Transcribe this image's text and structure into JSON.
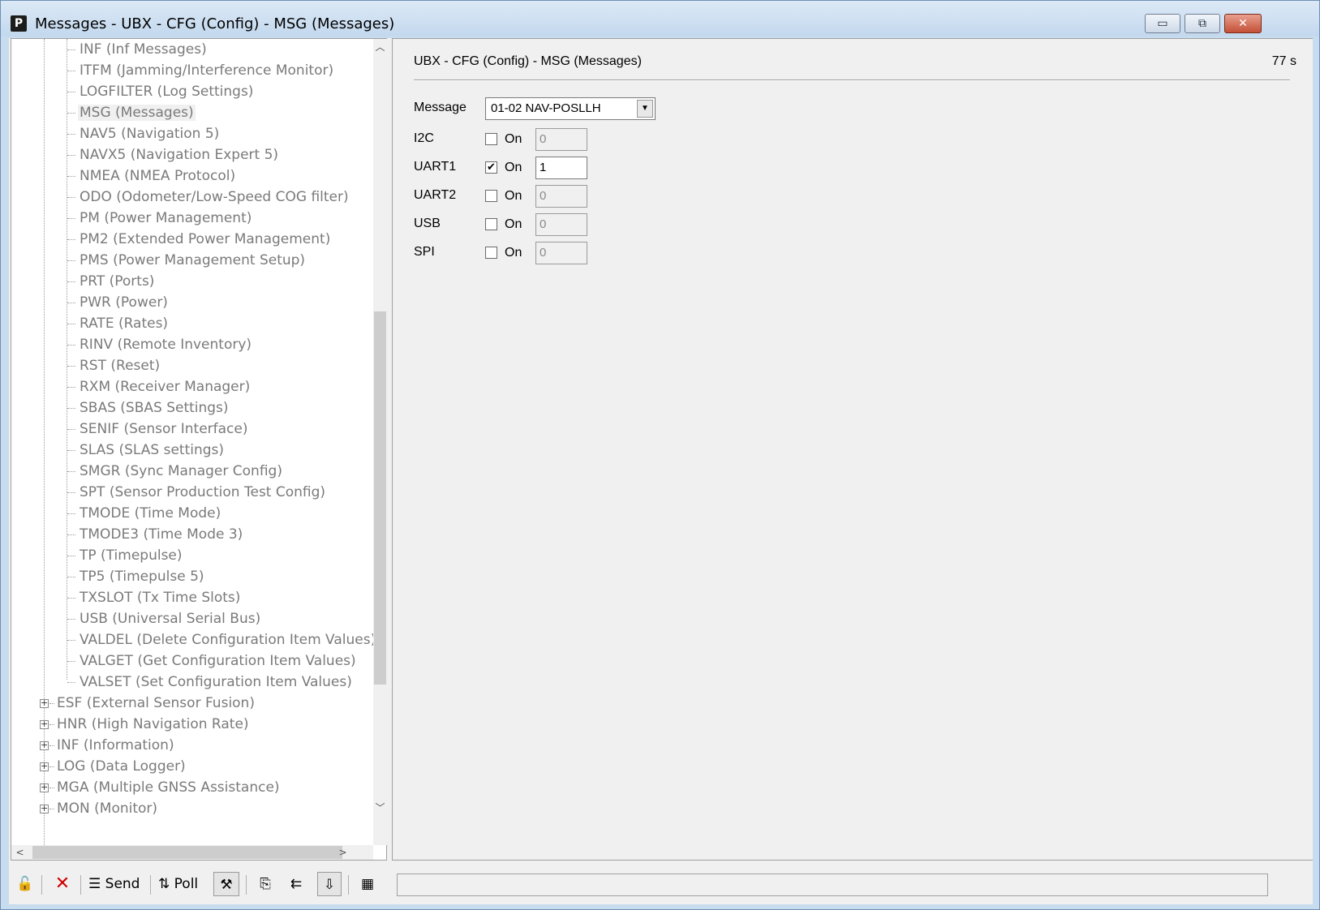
{
  "window": {
    "title": "Messages - UBX - CFG (Config) - MSG (Messages)",
    "app_icon_letter": "P",
    "minimize_glyph": "▭",
    "restore_glyph": "⧉",
    "close_glyph": "✕"
  },
  "tree": {
    "children": [
      "INF (Inf Messages)",
      "ITFM (Jamming/Interference Monitor)",
      "LOGFILTER (Log Settings)",
      "MSG (Messages)",
      "NAV5 (Navigation 5)",
      "NAVX5 (Navigation Expert 5)",
      "NMEA (NMEA Protocol)",
      "ODO (Odometer/Low-Speed COG filter)",
      "PM (Power Management)",
      "PM2 (Extended Power Management)",
      "PMS (Power Management Setup)",
      "PRT (Ports)",
      "PWR (Power)",
      "RATE (Rates)",
      "RINV (Remote Inventory)",
      "RST (Reset)",
      "RXM (Receiver Manager)",
      "SBAS (SBAS Settings)",
      "SENIF (Sensor Interface)",
      "SLAS (SLAS settings)",
      "SMGR (Sync Manager Config)",
      "SPT (Sensor Production Test Config)",
      "TMODE (Time Mode)",
      "TMODE3 (Time Mode 3)",
      "TP (Timepulse)",
      "TP5 (Timepulse 5)",
      "TXSLOT (Tx Time Slots)",
      "USB (Universal Serial Bus)",
      "VALDEL (Delete Configuration Item Values)",
      "VALGET (Get Configuration Item Values)",
      "VALSET (Set Configuration Item Values)"
    ],
    "selected": "MSG (Messages)",
    "groups": [
      "ESF (External Sensor Fusion)",
      "HNR (High Navigation Rate)",
      "INF (Information)",
      "LOG (Data Logger)",
      "MGA (Multiple GNSS Assistance)",
      "MON (Monitor)"
    ],
    "expander_glyph": "+"
  },
  "content": {
    "header": "UBX - CFG (Config) - MSG (Messages)",
    "age": "77 s",
    "message_label": "Message",
    "message_value": "01-02 NAV-POSLLH",
    "on_label": "On",
    "ports": [
      {
        "name": "I2C",
        "checked": false,
        "rate": "0"
      },
      {
        "name": "UART1",
        "checked": true,
        "rate": "1"
      },
      {
        "name": "UART2",
        "checked": false,
        "rate": "0"
      },
      {
        "name": "USB",
        "checked": false,
        "rate": "0"
      },
      {
        "name": "SPI",
        "checked": false,
        "rate": "0"
      }
    ]
  },
  "toolbar": {
    "send_label": "Send",
    "poll_label": "Poll",
    "icons": [
      "lock-icon",
      "delete-icon",
      "send-icon",
      "poll-icon",
      "auto-poll-icon",
      "copy-icon",
      "paste-icon",
      "load-icon",
      "record-icon"
    ]
  },
  "status": {
    "text": ""
  }
}
